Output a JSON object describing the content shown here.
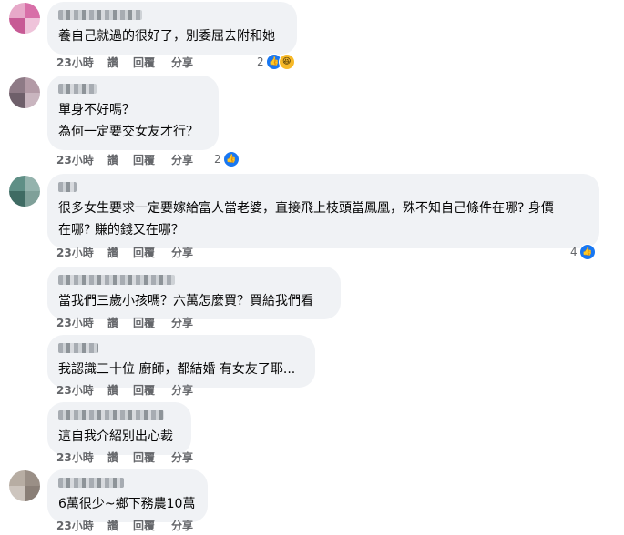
{
  "comments": [
    {
      "text": "養自己就過的很好了，別委屈去附和她",
      "time": "23小時",
      "like": "讚",
      "reply": "回覆",
      "share": "分享",
      "reaction_count": "2",
      "reactions": [
        "like-icon",
        "haha-icon"
      ]
    },
    {
      "text": "單身不好嗎？\n為何一定要交女友才行？",
      "time": "23小時",
      "like": "讚",
      "reply": "回覆",
      "share": "分享",
      "reaction_count": "2",
      "reactions": [
        "like-icon"
      ]
    },
    {
      "text": "很多女生要求一定要嫁給富人當老婆，直接飛上枝頭當鳳凰，殊不知自己條件在哪? 身價\n在哪? 賺的錢又在哪？",
      "time": "23小時",
      "like": "讚",
      "reply": "回覆",
      "share": "分享",
      "reaction_count": "4",
      "reactions": [
        "like-icon"
      ]
    },
    {
      "text": "當我們三歲小孩嗎？六萬怎麼買？買給我們看",
      "time": "23小時",
      "like": "讚",
      "reply": "回覆",
      "share": "分享"
    },
    {
      "text": "我認識三十位 廚師，都結婚 有女友了耶...",
      "time": "23小時",
      "like": "讚",
      "reply": "回覆",
      "share": "分享"
    },
    {
      "text": "這自我介紹別出心裁",
      "time": "23小時",
      "like": "讚",
      "reply": "回覆",
      "share": "分享"
    },
    {
      "text": "6萬很少~鄉下務農10萬",
      "time": "23小時",
      "like": "讚",
      "reply": "回覆",
      "share": "分享"
    }
  ],
  "colors": {
    "bubble": "#f0f2f5",
    "meta": "#65676b",
    "like_blue": "#1877f2"
  }
}
